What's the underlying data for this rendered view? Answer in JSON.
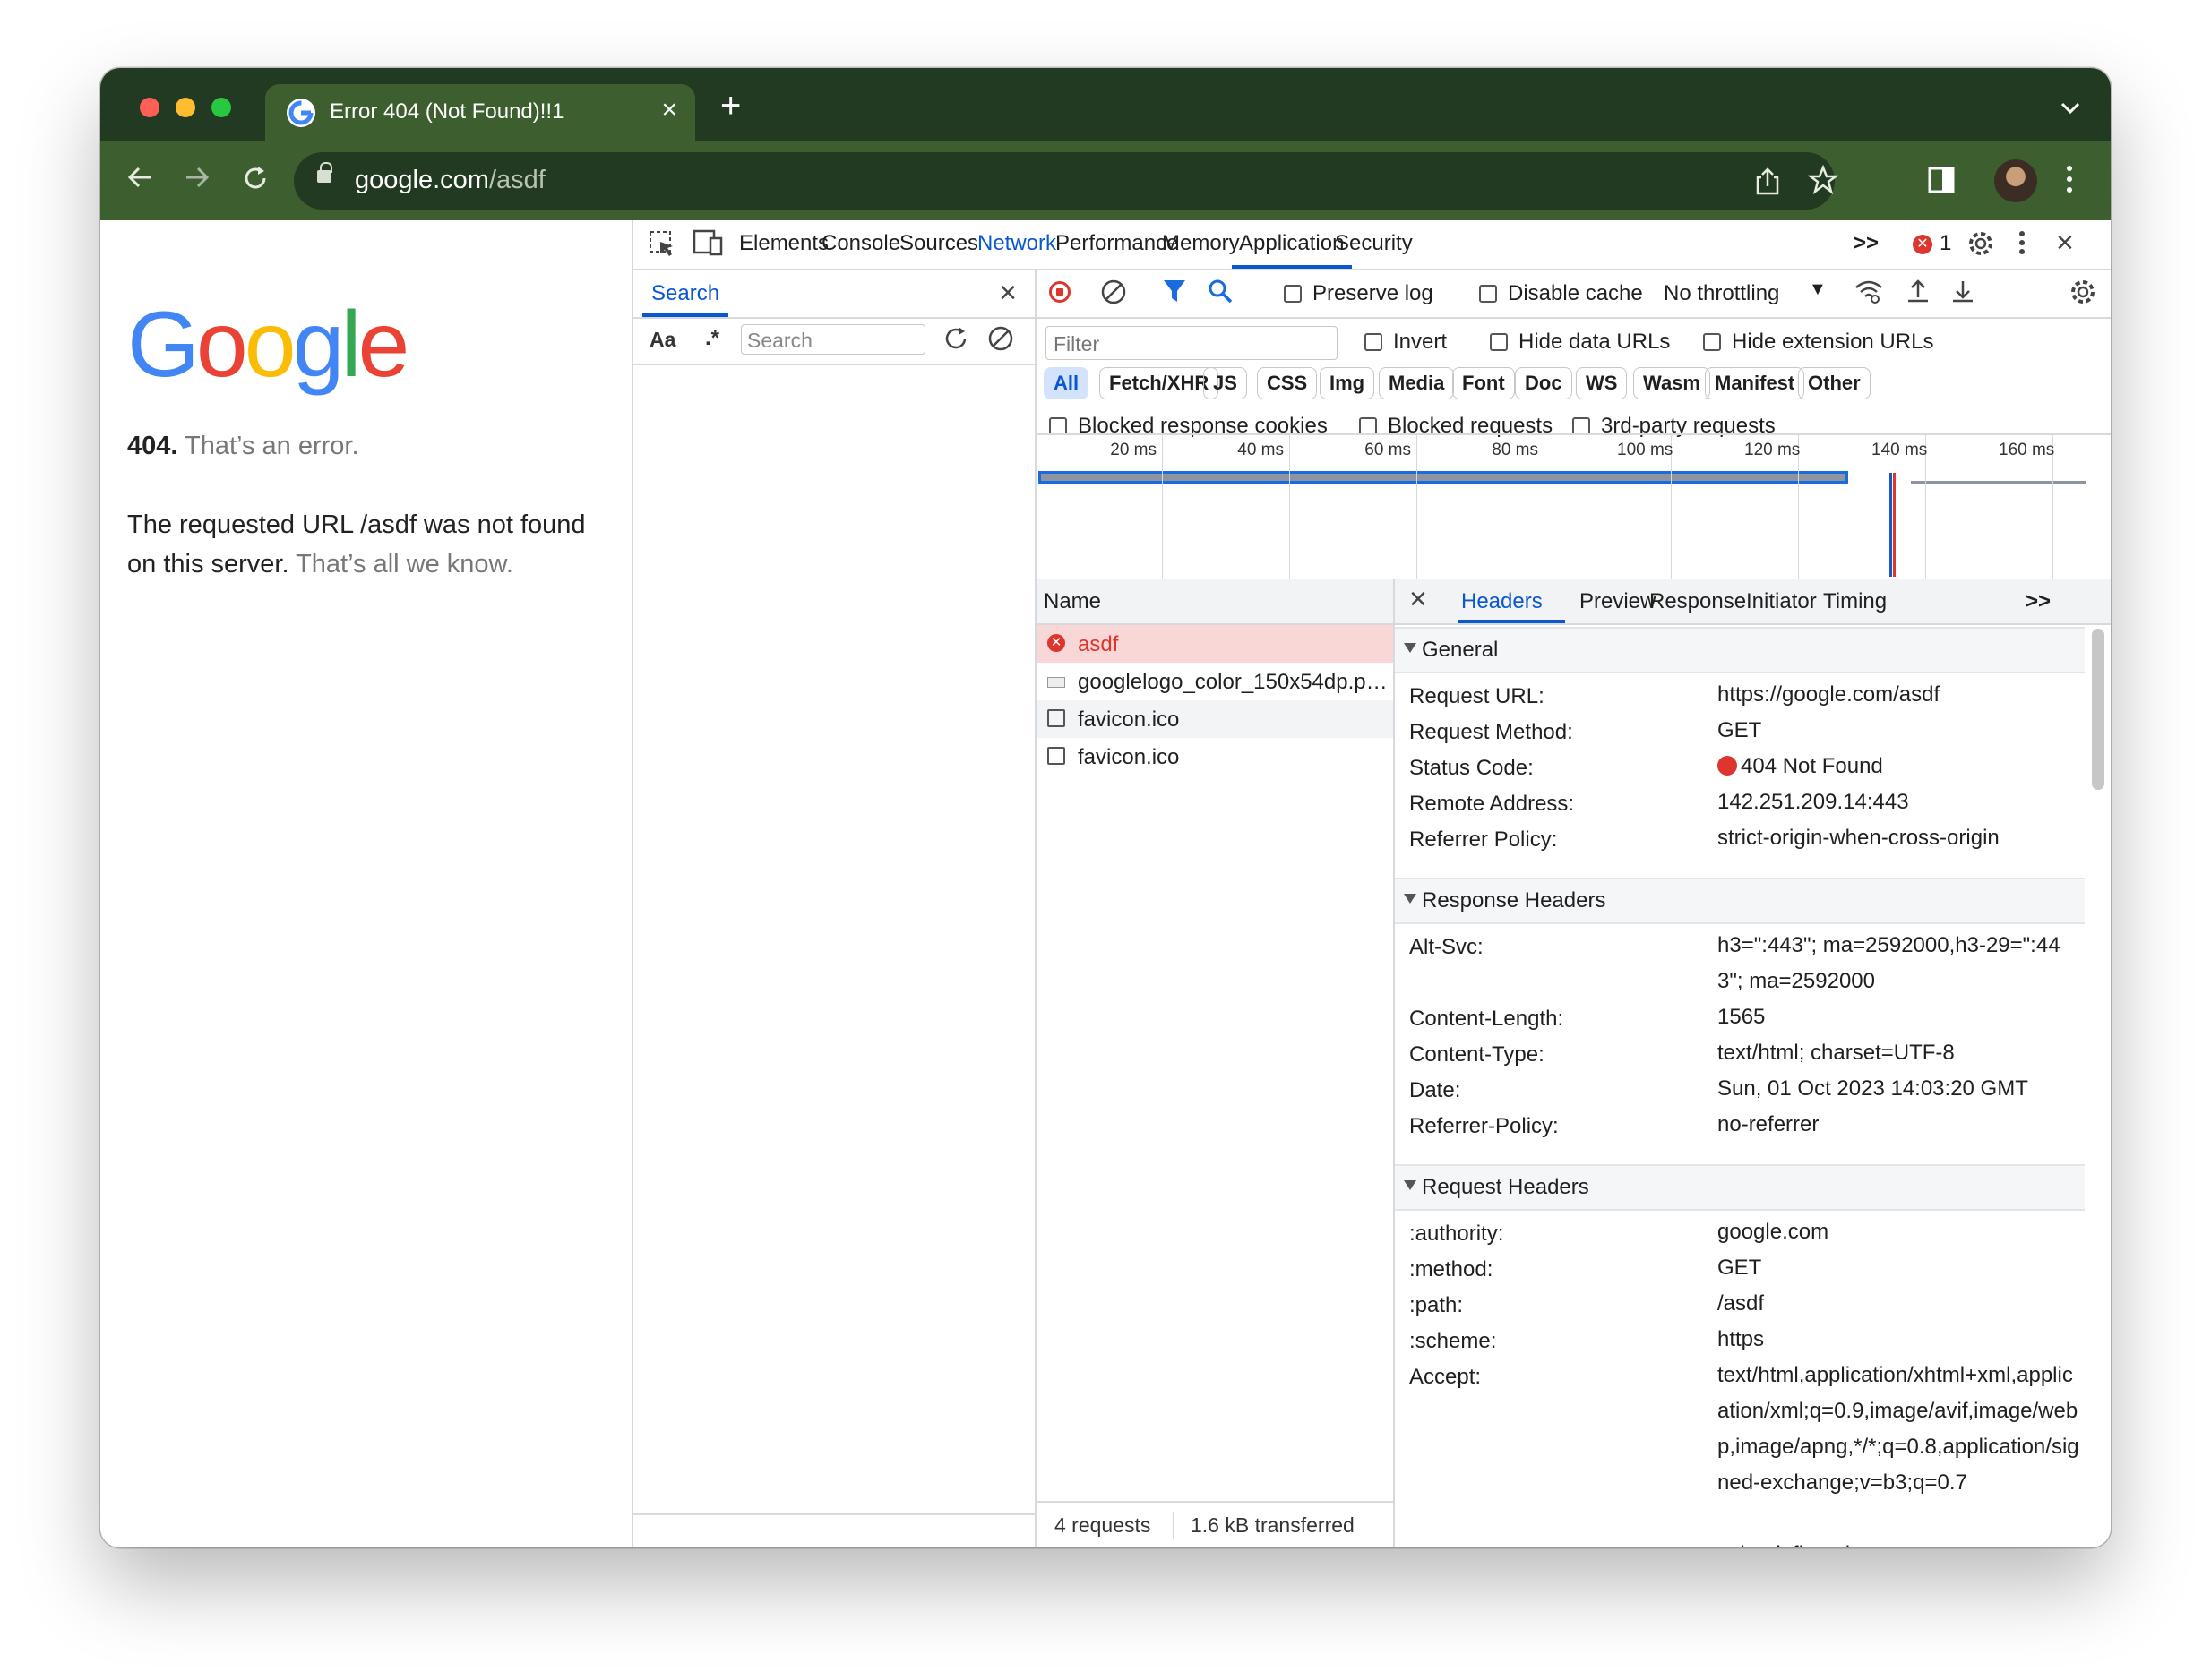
{
  "browser": {
    "tab_title": "Error 404 (Not Found)!!1",
    "url_host": "google.com",
    "url_path": "/asdf"
  },
  "page": {
    "logo": [
      "G",
      "o",
      "o",
      "g",
      "l",
      "e"
    ],
    "logo_colors": [
      "#4285f4",
      "#ea4335",
      "#fbbc05",
      "#4285f4",
      "#34a853",
      "#ea4335"
    ],
    "error_code": "404.",
    "error_text": "That’s an error.",
    "message": "The requested URL /asdf was not found on this server.",
    "message_tail": "That’s all we know."
  },
  "devtools": {
    "tabs": [
      "Elements",
      "Console",
      "Sources",
      "Network",
      "Performance",
      "Memory",
      "Application",
      "Security"
    ],
    "more_tabs": ">>",
    "active_tab": "Network",
    "error_count": "1",
    "search": {
      "title": "Search",
      "case_label": "Aa",
      "regex_label": ".*",
      "placeholder": "Search"
    },
    "network": {
      "preserve_log": "Preserve log",
      "disable_cache": "Disable cache",
      "throttling": "No throttling",
      "filter_placeholder": "Filter",
      "invert": "Invert",
      "hide_data_urls": "Hide data URLs",
      "hide_extension_urls": "Hide extension URLs",
      "type_filters": [
        "All",
        "Fetch/XHR",
        "JS",
        "CSS",
        "Img",
        "Media",
        "Font",
        "Doc",
        "WS",
        "Wasm",
        "Manifest",
        "Other"
      ],
      "blocked_cookies": "Blocked response cookies",
      "blocked_requests": "Blocked requests",
      "third_party": "3rd-party requests",
      "timeline_ticks": [
        "20 ms",
        "40 ms",
        "60 ms",
        "80 ms",
        "100 ms",
        "120 ms",
        "140 ms",
        "160 ms"
      ],
      "name_header": "Name",
      "requests": [
        {
          "name": "asdf",
          "type": "error"
        },
        {
          "name": "googlelogo_color_150x54dp.png",
          "type": "image"
        },
        {
          "name": "favicon.ico",
          "type": "doc"
        },
        {
          "name": "favicon.ico",
          "type": "doc"
        }
      ],
      "footer_requests": "4 requests",
      "footer_transferred": "1.6 kB transferred"
    },
    "detail": {
      "tabs": [
        "Headers",
        "Preview",
        "Response",
        "Initiator",
        "Timing"
      ],
      "more_tabs": ">>",
      "sections": {
        "general_title": "General",
        "general": [
          {
            "k": "Request URL:",
            "v": "https://google.com/asdf"
          },
          {
            "k": "Request Method:",
            "v": "GET"
          },
          {
            "k": "Status Code:",
            "v": "404 Not Found"
          },
          {
            "k": "Remote Address:",
            "v": "142.251.209.14:443"
          },
          {
            "k": "Referrer Policy:",
            "v": "strict-origin-when-cross-origin"
          }
        ],
        "response_title": "Response Headers",
        "response": [
          {
            "k": "Alt-Svc:",
            "v": "h3=\":443\"; ma=2592000,h3-29=\":443\"; ma=2592000"
          },
          {
            "k": "Content-Length:",
            "v": "1565"
          },
          {
            "k": "Content-Type:",
            "v": "text/html; charset=UTF-8"
          },
          {
            "k": "Date:",
            "v": "Sun, 01 Oct 2023 14:03:20 GMT"
          },
          {
            "k": "Referrer-Policy:",
            "v": "no-referrer"
          }
        ],
        "request_title": "Request Headers",
        "request": [
          {
            "k": ":authority:",
            "v": "google.com"
          },
          {
            "k": ":method:",
            "v": "GET"
          },
          {
            "k": ":path:",
            "v": "/asdf"
          },
          {
            "k": ":scheme:",
            "v": "https"
          },
          {
            "k": "Accept:",
            "v": "text/html,application/xhtml+xml,application/xml;q=0.9,image/avif,image/webp,image/apng,*/*;q=0.8,application/signed-exchange;v=b3;q=0.7"
          },
          {
            "k": "Accept-Encoding:",
            "v": "gzip, deflate, br"
          }
        ]
      }
    }
  }
}
